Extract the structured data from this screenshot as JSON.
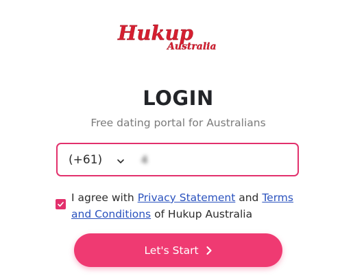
{
  "logo": {
    "main": "Hukup",
    "sub": "Australia",
    "color": "#d51f30"
  },
  "login": {
    "title": "LOGIN",
    "subtitle": "Free dating portal for Australians"
  },
  "phone": {
    "country_code": "(+61)",
    "chevron_icon": "chevron-down-icon",
    "value": "4"
  },
  "agreement": {
    "checked": true,
    "check_icon": "check-icon",
    "prefix": "I agree with ",
    "privacy_link": "Privacy Statement",
    "middle": " and ",
    "terms_link": "Terms and Conditions",
    "suffix": " of Hukup Australia"
  },
  "start_button": {
    "label": "Let's Start",
    "arrow_icon": "chevron-right-icon"
  },
  "colors": {
    "accent": "#ef3a72",
    "border": "#e2306c",
    "link": "#2a52be"
  }
}
